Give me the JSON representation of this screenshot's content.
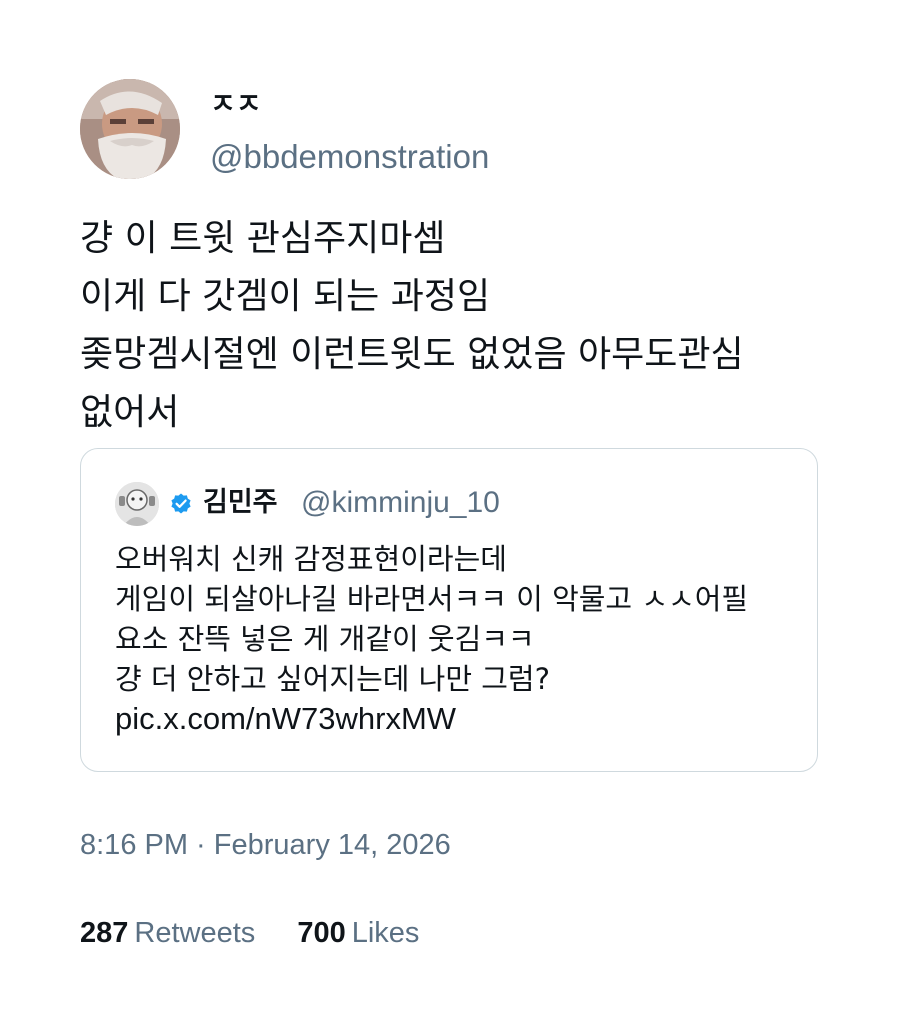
{
  "tweet": {
    "author": {
      "name": "ㅈㅈ",
      "handle": "@bbdemonstration",
      "avatar_icon": "bearded-man-avatar"
    },
    "body_lines": [
      "걍 이 트윗 관심주지마셈",
      "이게 다 갓겜이 되는 과정임",
      "좆망겜시절엔 이런트윗도 없었음 아무도관심",
      "없어서"
    ],
    "quote": {
      "name": "김민주",
      "handle": "@kimminju_10",
      "verified": true,
      "avatar_icon": "quoted-user-avatar",
      "body_lines": [
        "오버워치 신캐 감정표현이라는데",
        "게임이 되살아나길 바라면서ㅋㅋ 이 악물고 ㅅㅅ어필",
        "요소 잔뜩 넣은 게 개같이 웃김ㅋㅋ",
        "걍 더 안하고 싶어지는데 나만 그럼?"
      ],
      "link": "pic.x.com/nW73whrxMW"
    },
    "timestamp": "8:16 PM · February 14, 2026",
    "stats": {
      "retweets_count": "287",
      "retweets_label": "Retweets",
      "likes_count": "700",
      "likes_label": "Likes"
    },
    "colors": {
      "text": "#0f1419",
      "secondary": "#5b7083",
      "border": "#cfd9de",
      "verified": "#1d9bf0"
    }
  }
}
